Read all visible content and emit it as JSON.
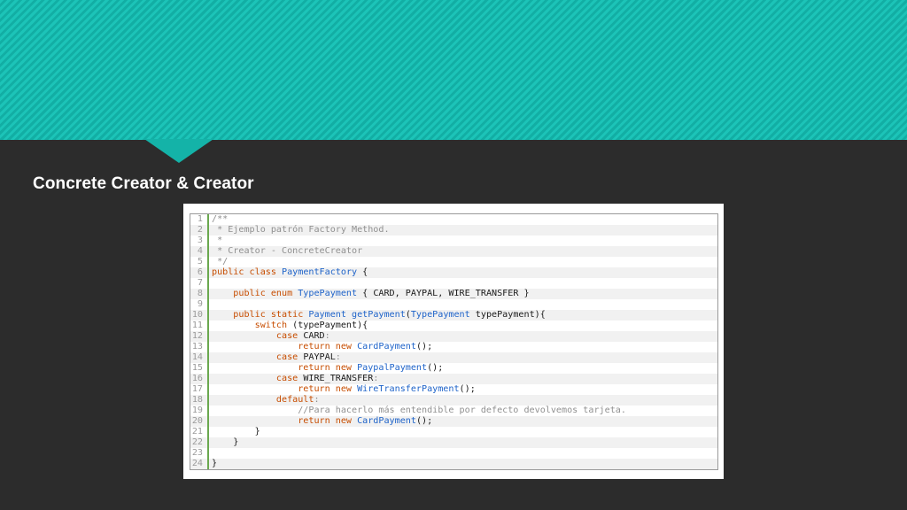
{
  "slide": {
    "title": "Concrete Creator & Creator"
  },
  "colors": {
    "banner_teal": "#16bdb1",
    "background_dark": "#2c2c2c",
    "code_keyword": "#c74d00",
    "code_type": "#1e63c9",
    "code_comment": "#909090",
    "gutter_line": "#6aa84f"
  },
  "code": {
    "lines": [
      {
        "num": "1",
        "tokens": [
          {
            "t": "/**",
            "c": "comment"
          }
        ]
      },
      {
        "num": "2",
        "tokens": [
          {
            "t": " * Ejemplo patrón Factory Method.",
            "c": "comment"
          }
        ]
      },
      {
        "num": "3",
        "tokens": [
          {
            "t": " *",
            "c": "comment"
          }
        ]
      },
      {
        "num": "4",
        "tokens": [
          {
            "t": " * Creator - ConcreteCreator",
            "c": "comment"
          }
        ]
      },
      {
        "num": "5",
        "tokens": [
          {
            "t": " */",
            "c": "comment"
          }
        ]
      },
      {
        "num": "6",
        "tokens": [
          {
            "t": "public class ",
            "c": "keyword"
          },
          {
            "t": "PaymentFactory",
            "c": "type"
          },
          {
            "t": " {",
            "c": "plain"
          }
        ]
      },
      {
        "num": "7",
        "tokens": []
      },
      {
        "num": "8",
        "tokens": [
          {
            "t": "    public enum ",
            "c": "keyword"
          },
          {
            "t": "TypePayment",
            "c": "type"
          },
          {
            "t": " { CARD, PAYPAL, WIRE_TRANSFER }",
            "c": "plain"
          }
        ]
      },
      {
        "num": "9",
        "tokens": []
      },
      {
        "num": "10",
        "tokens": [
          {
            "t": "    public static ",
            "c": "keyword"
          },
          {
            "t": "Payment getPayment",
            "c": "type"
          },
          {
            "t": "(",
            "c": "plain"
          },
          {
            "t": "TypePayment",
            "c": "type"
          },
          {
            "t": " typePayment){",
            "c": "plain"
          }
        ]
      },
      {
        "num": "11",
        "tokens": [
          {
            "t": "        switch",
            "c": "keyword"
          },
          {
            "t": " (typePayment){",
            "c": "plain"
          }
        ]
      },
      {
        "num": "12",
        "tokens": [
          {
            "t": "            case ",
            "c": "keyword"
          },
          {
            "t": "CARD",
            "c": "plain"
          },
          {
            "t": ":",
            "c": "comment"
          }
        ]
      },
      {
        "num": "13",
        "tokens": [
          {
            "t": "                return new ",
            "c": "keyword"
          },
          {
            "t": "CardPayment",
            "c": "type"
          },
          {
            "t": "();",
            "c": "plain"
          }
        ]
      },
      {
        "num": "14",
        "tokens": [
          {
            "t": "            case ",
            "c": "keyword"
          },
          {
            "t": "PAYPAL",
            "c": "plain"
          },
          {
            "t": ":",
            "c": "comment"
          }
        ]
      },
      {
        "num": "15",
        "tokens": [
          {
            "t": "                return new ",
            "c": "keyword"
          },
          {
            "t": "PaypalPayment",
            "c": "type"
          },
          {
            "t": "();",
            "c": "plain"
          }
        ]
      },
      {
        "num": "16",
        "tokens": [
          {
            "t": "            case ",
            "c": "keyword"
          },
          {
            "t": "WIRE_TRANSFER",
            "c": "plain"
          },
          {
            "t": ":",
            "c": "comment"
          }
        ]
      },
      {
        "num": "17",
        "tokens": [
          {
            "t": "                return new ",
            "c": "keyword"
          },
          {
            "t": "WireTransferPayment",
            "c": "type"
          },
          {
            "t": "();",
            "c": "plain"
          }
        ]
      },
      {
        "num": "18",
        "tokens": [
          {
            "t": "            default",
            "c": "keyword"
          },
          {
            "t": ":",
            "c": "comment"
          }
        ]
      },
      {
        "num": "19",
        "tokens": [
          {
            "t": "                //Para hacerlo más entendible por defecto devolvemos tarjeta.",
            "c": "comment"
          }
        ]
      },
      {
        "num": "20",
        "tokens": [
          {
            "t": "                return new ",
            "c": "keyword"
          },
          {
            "t": "CardPayment",
            "c": "type"
          },
          {
            "t": "();",
            "c": "plain"
          }
        ]
      },
      {
        "num": "21",
        "tokens": [
          {
            "t": "        }",
            "c": "plain"
          }
        ]
      },
      {
        "num": "22",
        "tokens": [
          {
            "t": "    }",
            "c": "plain"
          }
        ]
      },
      {
        "num": "23",
        "tokens": []
      },
      {
        "num": "24",
        "tokens": [
          {
            "t": "}",
            "c": "plain"
          }
        ]
      }
    ]
  }
}
